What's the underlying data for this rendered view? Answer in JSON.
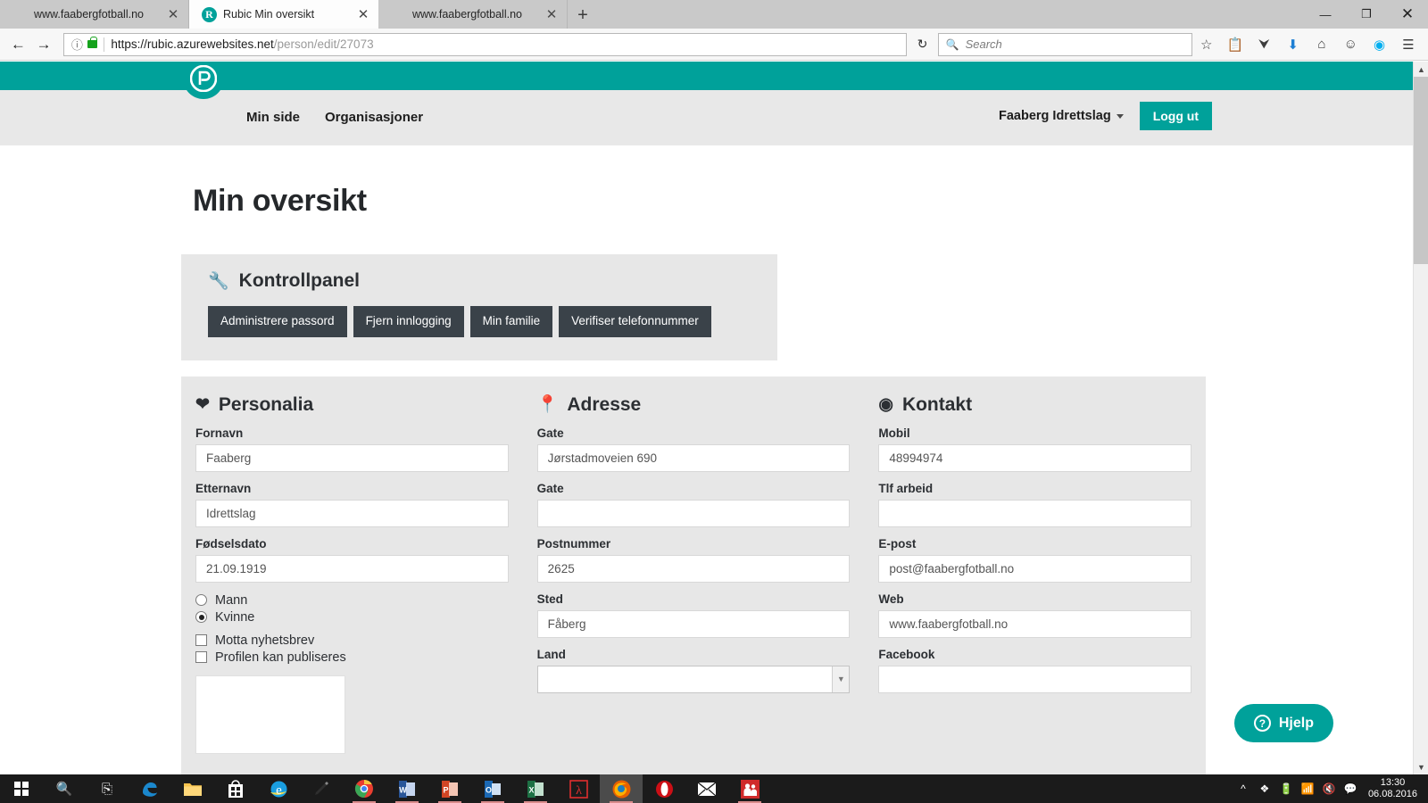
{
  "browser": {
    "tabs": [
      {
        "title": "www.faabergfotball.no",
        "favicon": "none",
        "active": false,
        "close_label": "✕"
      },
      {
        "title": "Rubic Min oversikt",
        "favicon": "rubic-icon",
        "active": true,
        "close_label": "✕"
      },
      {
        "title": "www.faabergfotball.no",
        "favicon": "none",
        "active": false,
        "close_label": "✕"
      }
    ],
    "newtab_label": "+",
    "window_controls": {
      "minimize": "—",
      "maximize": "❐",
      "close": "✕"
    },
    "back_label": "←",
    "forward_label": "→",
    "info_label": "ⓘ",
    "url_scheme": "https://rubic.azurewebsites.net",
    "url_path": "/person/edit/27073",
    "reload_label": "↻",
    "search_placeholder": "Search",
    "search_value": "",
    "toolbar_icons": [
      "star-icon",
      "library-icon",
      "pocket-icon",
      "downloads-icon",
      "home-icon",
      "smiley-icon",
      "skype-icon",
      "menu-icon"
    ]
  },
  "site": {
    "brand_color": "#00a19a",
    "logo_letter": "R",
    "nav": [
      {
        "label": "Min side"
      },
      {
        "label": "Organisasjoner"
      }
    ],
    "org_name": "Faaberg Idrettslag",
    "logout_label": "Logg ut",
    "page_title": "Min oversikt"
  },
  "control_panel": {
    "title": "Kontrollpanel",
    "icon": "wrench-icon",
    "buttons": [
      {
        "label": "Administrere passord"
      },
      {
        "label": "Fjern innlogging"
      },
      {
        "label": "Min familie"
      },
      {
        "label": "Verifiser telefonnummer"
      }
    ]
  },
  "personalia": {
    "title": "Personalia",
    "icon": "heart-icon",
    "fields": [
      {
        "label": "Fornavn",
        "value": "Faaberg"
      },
      {
        "label": "Etternavn",
        "value": "Idrettslag"
      },
      {
        "label": "Fødselsdato",
        "value": "21.09.1919"
      }
    ],
    "gender": [
      {
        "label": "Mann",
        "selected": false
      },
      {
        "label": "Kvinne",
        "selected": true
      }
    ],
    "checkboxes": [
      {
        "label": "Motta nyhetsbrev",
        "checked": false
      },
      {
        "label": "Profilen kan publiseres",
        "checked": false
      }
    ]
  },
  "adresse": {
    "title": "Adresse",
    "icon": "map-pin-icon",
    "fields": [
      {
        "label": "Gate",
        "value": "Jørstadmoveien 690"
      },
      {
        "label": "Gate",
        "value": ""
      },
      {
        "label": "Postnummer",
        "value": "2625"
      },
      {
        "label": "Sted",
        "value": "Fåberg"
      }
    ],
    "country": {
      "label": "Land",
      "value": "",
      "options": [
        ""
      ]
    }
  },
  "kontakt": {
    "title": "Kontakt",
    "icon": "play-circle-icon",
    "fields": [
      {
        "label": "Mobil",
        "value": "48994974"
      },
      {
        "label": "Tlf arbeid",
        "value": ""
      },
      {
        "label": "E-post",
        "value": "post@faabergfotball.no"
      },
      {
        "label": "Web",
        "value": "www.faabergfotball.no"
      },
      {
        "label": "Facebook",
        "value": ""
      }
    ]
  },
  "help": {
    "label": "Hjelp",
    "icon": "question-circle-icon"
  },
  "taskbar": {
    "start_icon": "windows-start-icon",
    "search_icon": "search-icon",
    "taskview_icon": "task-view-icon",
    "apps": [
      {
        "name": "edge-icon"
      },
      {
        "name": "file-explorer-icon"
      },
      {
        "name": "store-icon"
      },
      {
        "name": "internet-explorer-icon"
      },
      {
        "name": "snip-tool-icon"
      },
      {
        "name": "chrome-icon"
      },
      {
        "name": "word-icon"
      },
      {
        "name": "powerpoint-icon"
      },
      {
        "name": "outlook-icon"
      },
      {
        "name": "excel-icon"
      },
      {
        "name": "acrobat-icon"
      },
      {
        "name": "firefox-icon"
      },
      {
        "name": "opera-icon"
      },
      {
        "name": "mail-icon"
      },
      {
        "name": "people-icon"
      }
    ],
    "tray": [
      "chevron-up-icon",
      "dropbox-icon",
      "battery-icon",
      "wifi-icon",
      "volume-mute-icon",
      "action-center-icon"
    ],
    "time": "13:30",
    "date": "06.08.2016"
  }
}
